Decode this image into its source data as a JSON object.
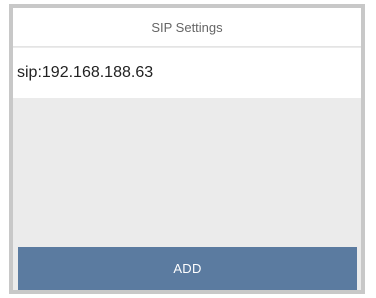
{
  "header": {
    "title": "SIP Settings"
  },
  "entries": [
    {
      "address": "sip:192.168.188.63"
    }
  ],
  "actions": {
    "add_label": "ADD"
  },
  "colors": {
    "button_background": "#5b7ba0",
    "panel_background": "#ebebeb",
    "frame_border": "#c8c8c8"
  }
}
